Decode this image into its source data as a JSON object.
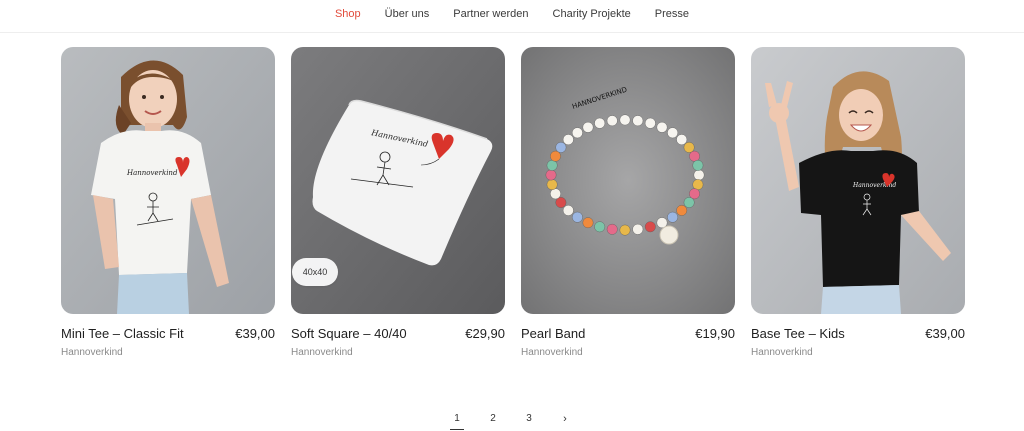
{
  "nav": {
    "items": [
      {
        "label": "Shop",
        "active": true
      },
      {
        "label": "Über uns",
        "active": false
      },
      {
        "label": "Partner werden",
        "active": false
      },
      {
        "label": "Charity Projekte",
        "active": false
      },
      {
        "label": "Presse",
        "active": false
      }
    ]
  },
  "products": [
    {
      "title": "Mini Tee – Classic Fit",
      "price": "€39,00",
      "brand": "Hannoverkind",
      "badge": ""
    },
    {
      "title": "Soft Square – 40/40",
      "price": "€29,90",
      "brand": "Hannoverkind",
      "badge": "40x40"
    },
    {
      "title": "Pearl Band",
      "price": "€19,90",
      "brand": "Hannoverkind",
      "badge": ""
    },
    {
      "title": "Base Tee – Kids",
      "price": "€39,00",
      "brand": "Hannoverkind",
      "badge": ""
    }
  ],
  "product_images": {
    "p0_print": "Hannoverkind",
    "p1_print": "Hannoverkind",
    "p2_beads": "HANNOVERKIND",
    "p3_print": "Hannoverkind"
  },
  "pagination": {
    "pages": [
      "1",
      "2",
      "3"
    ],
    "current": "1",
    "next_icon": "chevron-right-icon",
    "next_glyph": "›"
  },
  "colors": {
    "accent": "#e24b3b",
    "heart": "#d9342b",
    "text": "#1f1f1f",
    "muted": "#8a8a8a"
  }
}
